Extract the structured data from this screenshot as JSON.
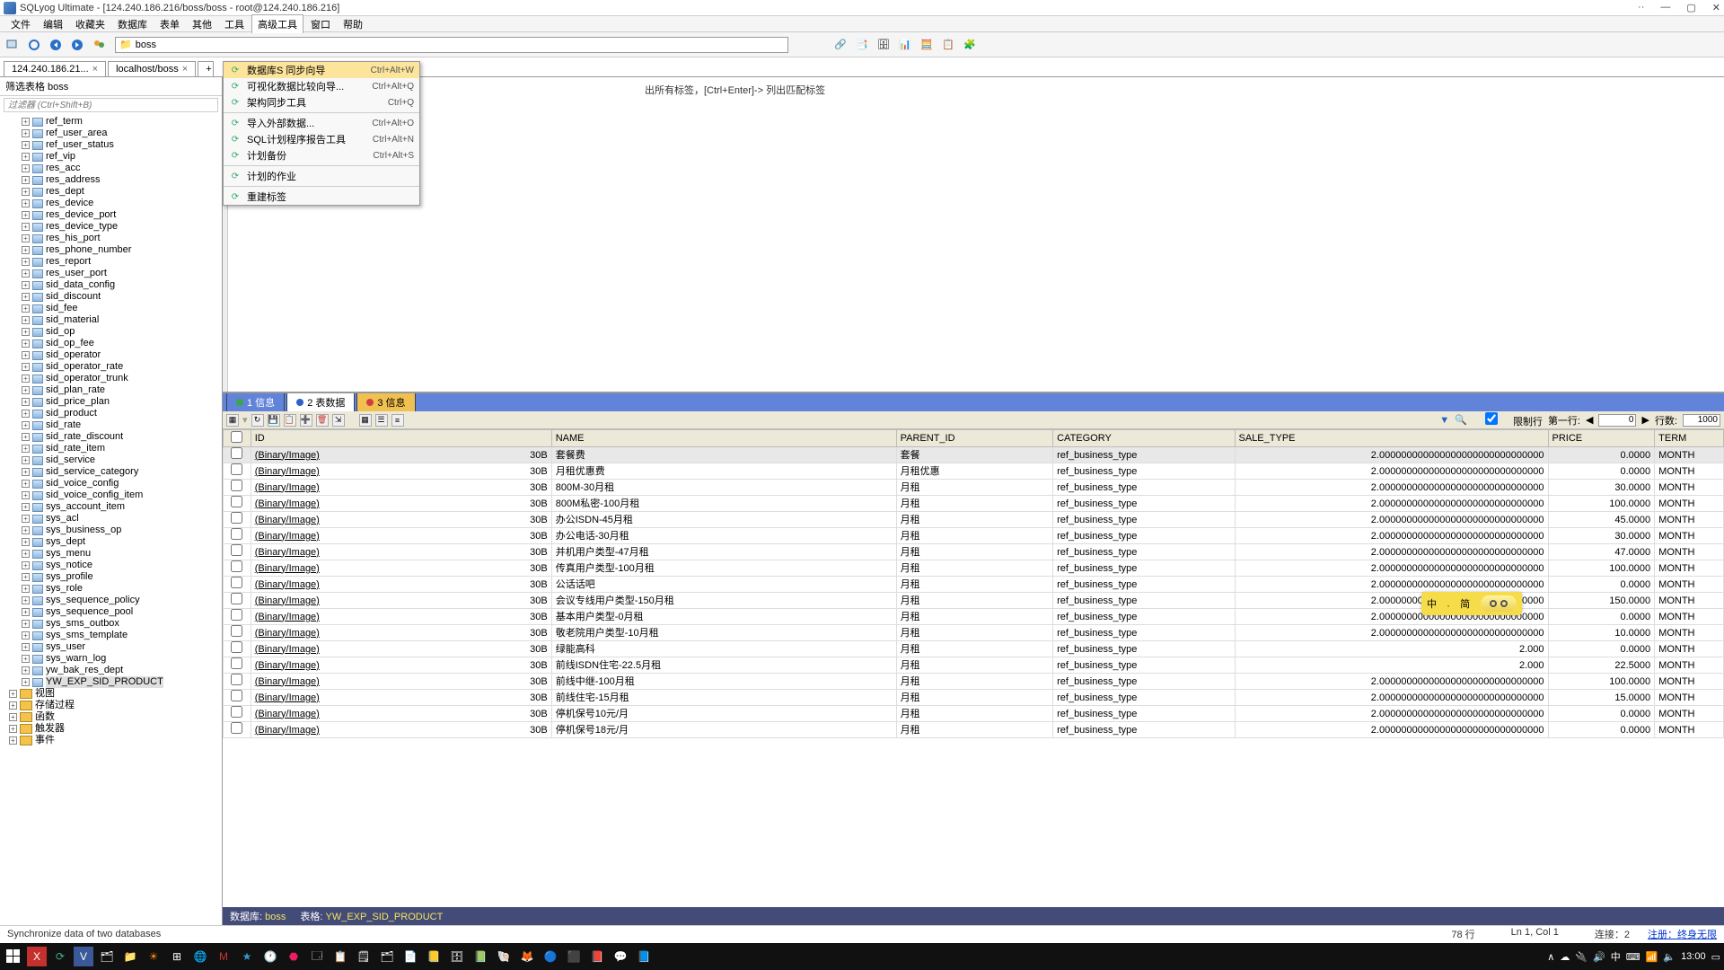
{
  "title": "SQLyog Ultimate - [124.240.186.216/boss/boss - root@124.240.186.216]",
  "menu": [
    "文件",
    "编辑",
    "收藏夹",
    "数据库",
    "表单",
    "其他",
    "工具",
    "高级工具",
    "窗口",
    "帮助"
  ],
  "active_menu_idx": 7,
  "path_value": "boss",
  "conn_tabs": [
    {
      "label": "124.240.186.21...",
      "close": true
    },
    {
      "label": "localhost/boss",
      "close": true
    }
  ],
  "side_head": "筛选表格 boss",
  "side_filter_ph": "过滤器 (Ctrl+Shift+B)",
  "dropdown": [
    {
      "icon": "sync",
      "label": "数据库S 同步向导",
      "sc": "Ctrl+Alt+W",
      "hl": true
    },
    {
      "icon": "diff",
      "label": "可视化数据比较向导...",
      "sc": "Ctrl+Alt+Q"
    },
    {
      "icon": "arch",
      "label": "架构同步工具",
      "sc": "Ctrl+Q"
    },
    {
      "sep": true
    },
    {
      "icon": "imp",
      "label": "导入外部数据...",
      "sc": "Ctrl+Alt+O"
    },
    {
      "icon": "rep",
      "label": "SQL计划程序报告工具",
      "sc": "Ctrl+Alt+N"
    },
    {
      "icon": "bak",
      "label": "计划备份",
      "sc": "Ctrl+Alt+S"
    },
    {
      "sep": true
    },
    {
      "icon": "job",
      "label": "计划的作业"
    },
    {
      "sep": true
    },
    {
      "icon": "tag",
      "label": "重建标签"
    }
  ],
  "editor_hint": "出所有标签，[Ctrl+Enter]-> 列出匹配标签",
  "tree": [
    "ref_term",
    "ref_user_area",
    "ref_user_status",
    "ref_vip",
    "res_acc",
    "res_address",
    "res_dept",
    "res_device",
    "res_device_port",
    "res_device_type",
    "res_his_port",
    "res_phone_number",
    "res_report",
    "res_user_port",
    "sid_data_config",
    "sid_discount",
    "sid_fee",
    "sid_material",
    "sid_op",
    "sid_op_fee",
    "sid_operator",
    "sid_operator_rate",
    "sid_operator_trunk",
    "sid_plan_rate",
    "sid_price_plan",
    "sid_product",
    "sid_rate",
    "sid_rate_discount",
    "sid_rate_item",
    "sid_service",
    "sid_service_category",
    "sid_voice_config",
    "sid_voice_config_item",
    "sys_account_item",
    "sys_acl",
    "sys_business_op",
    "sys_dept",
    "sys_menu",
    "sys_notice",
    "sys_profile",
    "sys_role",
    "sys_sequence_policy",
    "sys_sequence_pool",
    "sys_sms_outbox",
    "sys_sms_template",
    "sys_user",
    "sys_warn_log",
    "yw_bak_res_dept"
  ],
  "tree_sel": "YW_EXP_SID_PRODUCT",
  "tree_folders": [
    "视图",
    "存储过程",
    "函数",
    "触发器",
    "事件"
  ],
  "res_tabs": [
    {
      "dot": "#3aa848",
      "label": "1 信息"
    },
    {
      "dot": "#3060c8",
      "label": "2 表数据",
      "act": true
    },
    {
      "dot": "#d04040",
      "label": "3 信息"
    }
  ],
  "limit": {
    "chk_label": "限制行",
    "first_label": "第一行:",
    "first": "0",
    "rows_label": "行数:",
    "rows": "1000"
  },
  "cols": [
    "ID",
    "NAME",
    "PARENT_ID",
    "CATEGORY",
    "SALE_TYPE",
    "PRICE",
    "TERM"
  ],
  "rows": [
    {
      "id": "(Binary/Image)",
      "sz": "30B",
      "name": "套餐费",
      "parent": "套餐",
      "cat": "ref_business_type",
      "sale": "2.000000000000000000000000000000",
      "price": "0.0000",
      "term": "MONTH"
    },
    {
      "id": "(Binary/Image)",
      "sz": "30B",
      "name": "月租优惠费",
      "parent": "月租优惠",
      "cat": "ref_business_type",
      "sale": "2.000000000000000000000000000000",
      "price": "0.0000",
      "term": "MONTH"
    },
    {
      "id": "(Binary/Image)",
      "sz": "30B",
      "name": "800M-30月租",
      "parent": "月租",
      "cat": "ref_business_type",
      "sale": "2.000000000000000000000000000000",
      "price": "30.0000",
      "term": "MONTH"
    },
    {
      "id": "(Binary/Image)",
      "sz": "30B",
      "name": "800M私密-100月租",
      "parent": "月租",
      "cat": "ref_business_type",
      "sale": "2.000000000000000000000000000000",
      "price": "100.0000",
      "term": "MONTH"
    },
    {
      "id": "(Binary/Image)",
      "sz": "30B",
      "name": "办公ISDN-45月租",
      "parent": "月租",
      "cat": "ref_business_type",
      "sale": "2.000000000000000000000000000000",
      "price": "45.0000",
      "term": "MONTH"
    },
    {
      "id": "(Binary/Image)",
      "sz": "30B",
      "name": "办公电话-30月租",
      "parent": "月租",
      "cat": "ref_business_type",
      "sale": "2.000000000000000000000000000000",
      "price": "30.0000",
      "term": "MONTH"
    },
    {
      "id": "(Binary/Image)",
      "sz": "30B",
      "name": "并机用户类型-47月租",
      "parent": "月租",
      "cat": "ref_business_type",
      "sale": "2.000000000000000000000000000000",
      "price": "47.0000",
      "term": "MONTH"
    },
    {
      "id": "(Binary/Image)",
      "sz": "30B",
      "name": "传真用户类型-100月租",
      "parent": "月租",
      "cat": "ref_business_type",
      "sale": "2.000000000000000000000000000000",
      "price": "100.0000",
      "term": "MONTH"
    },
    {
      "id": "(Binary/Image)",
      "sz": "30B",
      "name": "公话话吧",
      "parent": "月租",
      "cat": "ref_business_type",
      "sale": "2.000000000000000000000000000000",
      "price": "0.0000",
      "term": "MONTH"
    },
    {
      "id": "(Binary/Image)",
      "sz": "30B",
      "name": "会议专线用户类型-150月租",
      "parent": "月租",
      "cat": "ref_business_type",
      "sale": "2.000000000000000000000000000000",
      "price": "150.0000",
      "term": "MONTH"
    },
    {
      "id": "(Binary/Image)",
      "sz": "30B",
      "name": "基本用户类型-0月租",
      "parent": "月租",
      "cat": "ref_business_type",
      "sale": "2.000000000000000000000000000000",
      "price": "0.0000",
      "term": "MONTH"
    },
    {
      "id": "(Binary/Image)",
      "sz": "30B",
      "name": "敬老院用户类型-10月租",
      "parent": "月租",
      "cat": "ref_business_type",
      "sale": "2.000000000000000000000000000000",
      "price": "10.0000",
      "term": "MONTH"
    },
    {
      "id": "(Binary/Image)",
      "sz": "30B",
      "name": "绿能高科",
      "parent": "月租",
      "cat": "ref_business_type",
      "sale": "2.000",
      "price": "0.0000",
      "term": "MONTH"
    },
    {
      "id": "(Binary/Image)",
      "sz": "30B",
      "name": "前线ISDN住宅-22.5月租",
      "parent": "月租",
      "cat": "ref_business_type",
      "sale": "2.000",
      "price": "22.5000",
      "term": "MONTH"
    },
    {
      "id": "(Binary/Image)",
      "sz": "30B",
      "name": "前线中继-100月租",
      "parent": "月租",
      "cat": "ref_business_type",
      "sale": "2.000000000000000000000000000000",
      "price": "100.0000",
      "term": "MONTH"
    },
    {
      "id": "(Binary/Image)",
      "sz": "30B",
      "name": "前线住宅-15月租",
      "parent": "月租",
      "cat": "ref_business_type",
      "sale": "2.000000000000000000000000000000",
      "price": "15.0000",
      "term": "MONTH"
    },
    {
      "id": "(Binary/Image)",
      "sz": "30B",
      "name": "停机保号10元/月",
      "parent": "月租",
      "cat": "ref_business_type",
      "sale": "2.000000000000000000000000000000",
      "price": "0.0000",
      "term": "MONTH"
    },
    {
      "id": "(Binary/Image)",
      "sz": "30B",
      "name": "停机保号18元/月",
      "parent": "月租",
      "cat": "ref_business_type",
      "sale": "2.000000000000000000000000000000",
      "price": "0.0000",
      "term": "MONTH"
    }
  ],
  "status": {
    "db_lbl": "数据库:",
    "db": "boss",
    "tbl_lbl": "表格:",
    "tbl": "YW_EXP_SID_PRODUCT"
  },
  "bottom": {
    "msg": "Synchronize data of two databases",
    "rows": "78 行",
    "pos": "Ln 1, Col 1",
    "conn": "连接：2",
    "reg": "注册：终身无限"
  },
  "tray_time": "13:00"
}
